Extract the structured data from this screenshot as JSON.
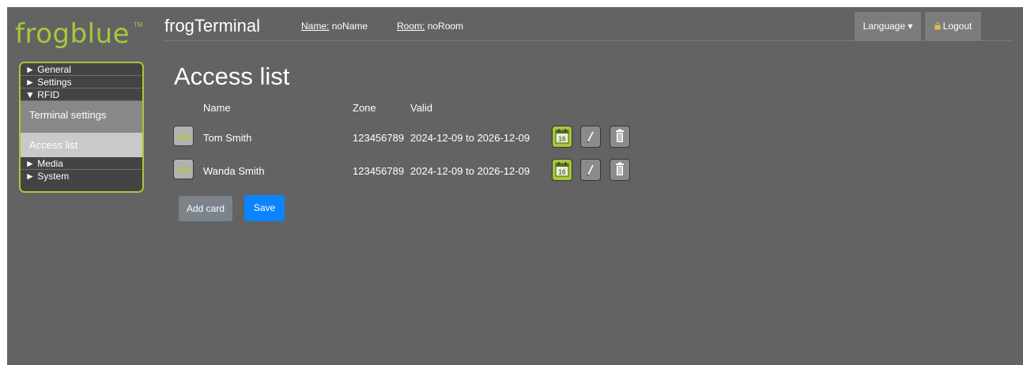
{
  "logo": {
    "text": "frogblue",
    "tm": "TM"
  },
  "sidebar": {
    "groups": [
      {
        "label": "► General"
      },
      {
        "label": "► Settings"
      },
      {
        "label": "▼ RFID"
      },
      {
        "label": "► Media"
      },
      {
        "label": "► System"
      }
    ],
    "rfid_items": [
      {
        "label": "Terminal settings"
      },
      {
        "label": "Access list"
      }
    ]
  },
  "header": {
    "title": "frogTerminal",
    "name_label": "Name:",
    "name_value": "noName",
    "room_label": "Room:",
    "room_value": "noRoom",
    "language": "Language ▾",
    "logout": "Logout"
  },
  "main": {
    "title": "Access list",
    "columns": {
      "name": "Name",
      "zone": "Zone",
      "valid": "Valid"
    },
    "rows": [
      {
        "name": "Tom Smith",
        "zone": "123456789",
        "valid": "2024-12-09 to 2026-12-09"
      },
      {
        "name": "Wanda Smith",
        "zone": "123456789",
        "valid": "2024-12-09 to 2026-12-09"
      }
    ],
    "calendar_day": "16",
    "add_card": "Add card",
    "save": "Save"
  },
  "colors": {
    "brand": "#a6c83c",
    "background": "#636363",
    "primary_button": "#0a84ff"
  },
  "icons": [
    "key-icon",
    "calendar-icon",
    "pencil-icon",
    "trash-icon",
    "lock-icon"
  ]
}
